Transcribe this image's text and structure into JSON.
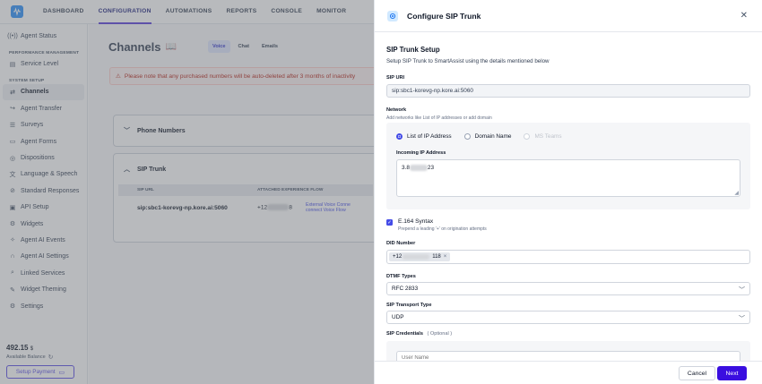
{
  "nav": {
    "tabs": [
      {
        "label": "DASHBOARD"
      },
      {
        "label": "CONFIGURATION"
      },
      {
        "label": "AUTOMATIONS"
      },
      {
        "label": "REPORTS"
      },
      {
        "label": "CONSOLE"
      },
      {
        "label": "MONITOR"
      }
    ],
    "active_color": "#5a3ddb"
  },
  "sidebar": {
    "agent_status": "Agent Status",
    "section_perf": "PERFORMANCE MANAGEMENT",
    "service_level": "Service Level",
    "section_system": "SYSTEM SETUP",
    "items": [
      {
        "label": "Channels",
        "icon": "channels-icon"
      },
      {
        "label": "Agent Transfer",
        "icon": "transfer-icon"
      },
      {
        "label": "Surveys",
        "icon": "survey-icon"
      },
      {
        "label": "Agent Forms",
        "icon": "form-icon"
      },
      {
        "label": "Dispositions",
        "icon": "disposition-icon"
      },
      {
        "label": "Language & Speech",
        "icon": "language-icon"
      },
      {
        "label": "Standard Responses",
        "icon": "responses-icon"
      },
      {
        "label": "API Setup",
        "icon": "api-icon"
      },
      {
        "label": "Widgets",
        "icon": "widget-icon"
      },
      {
        "label": "Agent AI Events",
        "icon": "ai-events-icon"
      },
      {
        "label": "Agent AI Settings",
        "icon": "ai-settings-icon"
      },
      {
        "label": "Linked Services",
        "icon": "link-icon"
      },
      {
        "label": "Widget Theming",
        "icon": "theming-icon"
      },
      {
        "label": "Settings",
        "icon": "gear-icon"
      }
    ],
    "balance_value": "492.15",
    "balance_unit": "$",
    "balance_label": "Available Balance",
    "setup_payment": "Setup Payment"
  },
  "main": {
    "title": "Channels",
    "channel_tabs": [
      {
        "label": "Voice"
      },
      {
        "label": "Chat"
      },
      {
        "label": "Emails"
      }
    ],
    "warning": "Please note that any purchased numbers will be auto-deleted after 3 months of inactivity",
    "phone_numbers": "Phone Numbers",
    "sip_trunk": "SIP Trunk",
    "table_headers": [
      "SIP URL",
      "ATTACHED EXPERIENCE FLOW"
    ],
    "row": {
      "sip_url": "sip:sbc1-korevg-np.kore.ai:5060",
      "number_prefix": "+12",
      "number_suffix": "8",
      "link_1": "External Voice Conne",
      "link_2": "connect Voice Flow"
    }
  },
  "drawer": {
    "title": "Configure SIP Trunk",
    "section_title": "SIP Trunk Setup",
    "section_sub": "Setup SIP Trunk to SmartAssist using the details mentioned below",
    "sip_uri_label": "SIP URI",
    "sip_uri_value": "sip:sbc1-korevg-np.kore.ai:5060",
    "network_label": "Network",
    "network_sub": "Add networks like List of IP addresses or add domain",
    "radio_options": [
      "List of IP Address",
      "Domain Name",
      "MS Teams"
    ],
    "incoming_ip_label": "Incoming IP Address",
    "ip_prefix": "3.8",
    "ip_suffix": "23",
    "e164_label": "E.164 Syntax",
    "e164_sub": "Prepend a leading '+' on origination attempts",
    "did_label": "DID Number",
    "did_prefix": "+12",
    "did_suffix": "118",
    "dtmf_label": "DTMF Types",
    "dtmf_value": "RFC 2833",
    "transport_label": "SIP Transport Type",
    "transport_value": "UDP",
    "credentials_label": "SIP Credentials",
    "credentials_optional": "( Optional )",
    "username_placeholder": "User Name",
    "cancel": "Cancel",
    "next": "Next"
  }
}
